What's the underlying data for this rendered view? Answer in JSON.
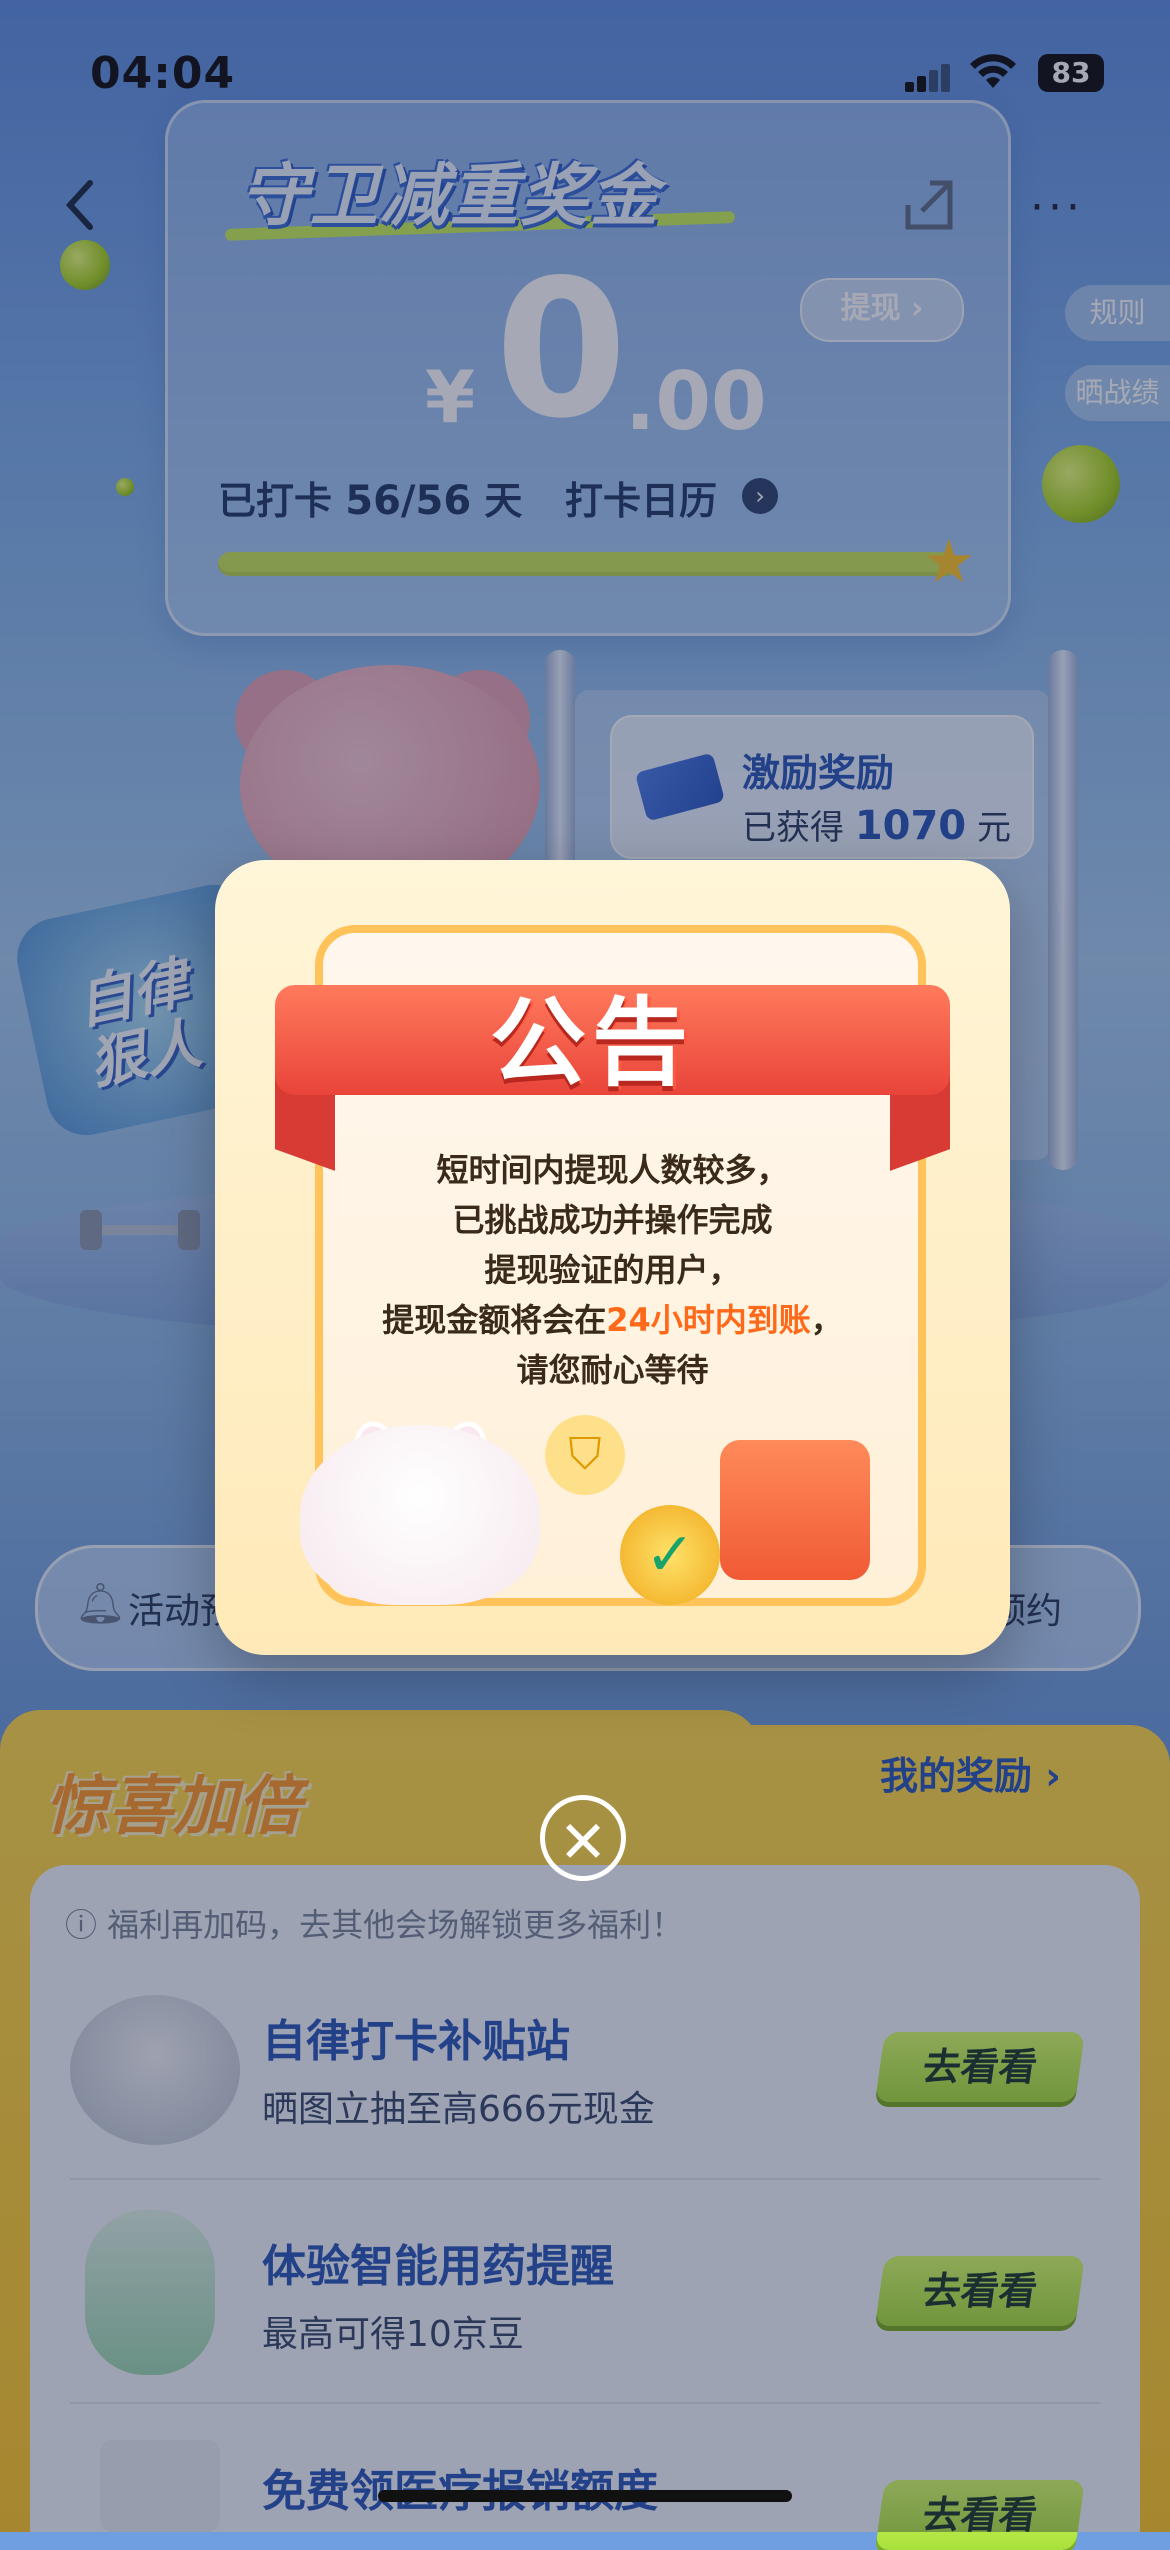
{
  "status_bar": {
    "time": "04:04",
    "battery": "83"
  },
  "header": {
    "back_icon": "chevron-left-icon",
    "share_icon": "share-icon",
    "more_label": "···"
  },
  "top_card": {
    "title": "守卫减重奖金",
    "withdraw_label": "提现 ›",
    "currency": "¥",
    "amount_int": "0",
    "amount_dec": ".00",
    "checkin_prefix": "已打卡",
    "checkin_count": "56/56",
    "checkin_unit": "天",
    "calendar_label": "打卡日历",
    "progress": 1.0
  },
  "side_tabs": {
    "rules": "规则",
    "share": "晒战绩"
  },
  "reward_card": {
    "title": "激励奖励",
    "sub_prefix": "已获得",
    "amount": "1070",
    "unit": "元"
  },
  "badge_text": "自律狠人",
  "notice_bar": {
    "left": "活动预",
    "right": "预约"
  },
  "modal": {
    "title": "公告",
    "lines": [
      "短时间内提现人数较多，",
      "已挑战成功并操作完成",
      "提现验证的用户，"
    ],
    "line4_prefix": "提现金额将会在",
    "line4_highlight": "24小时内到账",
    "line4_suffix": "，",
    "line5": "请您耐心等待",
    "close_label": "✕"
  },
  "bonus_section": {
    "title": "惊喜加倍",
    "my_reward": "我的奖励 ›",
    "tip": "ⓘ 福利再加码，去其他会场解锁更多福利！",
    "items": [
      {
        "title": "自律打卡补贴站",
        "sub": "晒图立抽至高666元现金",
        "button": "去看看"
      },
      {
        "title": "体验智能用药提醒",
        "sub": "最高可得10京豆",
        "button": "去看看"
      },
      {
        "title": "免费领医疗报销额度",
        "sub": "",
        "button": "去看看"
      }
    ]
  },
  "colors": {
    "accent_blue": "#2c57b8",
    "green_button": "#a8e03a",
    "yellow_bg": "#ffd94a",
    "highlight_orange": "#ff6a1a"
  }
}
